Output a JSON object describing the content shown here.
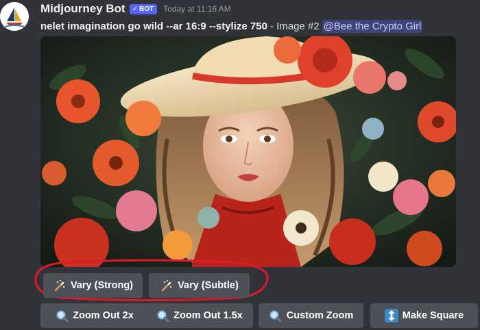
{
  "message": {
    "author": "Midjourney Bot",
    "badge": "BOT",
    "timestamp": "Today at 11:16 AM",
    "prompt": "nelet imagination go wild --ar 16:9 --stylize 750",
    "image_index": "- Image #2",
    "mention": "@Bee the Crypto Girl"
  },
  "image": {
    "subject": "young woman with wavy hair, wide-brimmed cream hat and red scarf surrounded by red, orange and pink flowers"
  },
  "buttons": {
    "row1": [
      {
        "label": "Vary (Strong)",
        "icon": "magic-wand-icon"
      },
      {
        "label": "Vary (Subtle)",
        "icon": "magic-wand-icon"
      }
    ],
    "row2": [
      {
        "label": "Zoom Out 2x",
        "icon": "magnifier-icon"
      },
      {
        "label": "Zoom Out 1.5x",
        "icon": "magnifier-icon"
      },
      {
        "label": "Custom Zoom",
        "icon": "magnifier-icon"
      },
      {
        "label": "Make Square",
        "icon": "up-down-arrow-icon"
      }
    ]
  },
  "annotation": {
    "color": "#e0182b"
  },
  "colors": {
    "background": "#313338",
    "button": "#4e5058",
    "badge": "#5865f2",
    "mention_bg": "#3c4270"
  }
}
